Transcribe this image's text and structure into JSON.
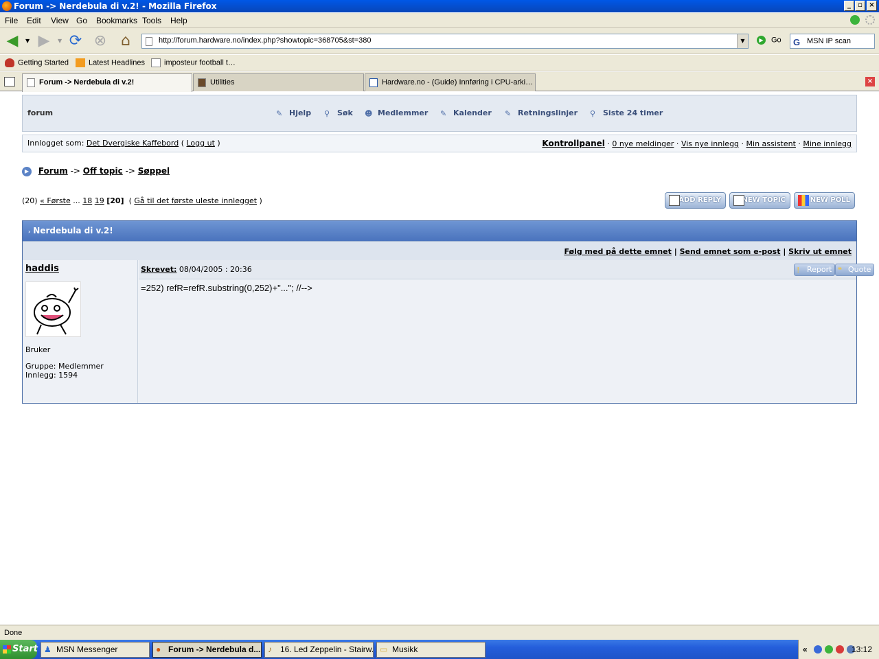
{
  "window": {
    "title": "Forum -> Nerdebula di v.2! - Mozilla Firefox"
  },
  "menubar": [
    "File",
    "Edit",
    "View",
    "Go",
    "Bookmarks",
    "Tools",
    "Help"
  ],
  "toolbar": {
    "url": "http://forum.hardware.no/index.php?showtopic=368705&st=380",
    "go_label": "Go",
    "search_value": "MSN IP scan"
  },
  "bookmarks": [
    "Getting Started",
    "Latest Headlines",
    "imposteur football t…"
  ],
  "tabs": [
    {
      "label": "Forum -> Nerdebula di v.2!"
    },
    {
      "label": "Utilities"
    },
    {
      "label": "Hardware.no - (Guide) Innføring i CPU-arki…"
    }
  ],
  "forum": {
    "logo": "forum",
    "nav": [
      "Hjelp",
      "Søk",
      "Medlemmer",
      "Kalender",
      "Retningslinjer",
      "Siste 24 timer"
    ],
    "userbar": {
      "logged_in_as": "Innlogget som:",
      "username": "Det Dvergiske Kaffebord",
      "open_paren": "(",
      "logout": "Logg ut",
      "close_paren": ")",
      "control_panel": "Kontrollpanel",
      "links": [
        "0 nye meldinger",
        "Vis nye innlegg",
        "Min assistent",
        "Mine innlegg"
      ]
    },
    "breadcrumb": [
      "Forum",
      "Off topic",
      "Søppel"
    ],
    "breadcrumb_sep": "->",
    "pager": {
      "count": "(20)",
      "first": "« Første",
      "ellipsis": "...",
      "pages": [
        "18",
        "19"
      ],
      "current": "[20]",
      "open": "(",
      "first_unread": "Gå til det første uleste innlegget",
      "close": ")"
    },
    "actions": [
      "ADD REPLY",
      "NEW TOPIC",
      "NEW POLL"
    ],
    "topic_title": "Nerdebula di v.2!",
    "topic_links": [
      "Følg med på dette emnet",
      "Send emnet som e-post",
      "Skriv ut emnet"
    ],
    "post": {
      "author": "haddis",
      "rank": "Bruker",
      "group": "Gruppe: Medlemmer",
      "posts": "Innlegg: 1594",
      "written_label": "Skrevet:",
      "date": "08/04/2005 : 20:36",
      "report_label": "Report",
      "quote_label": "Quote",
      "body": "=252) refR=refR.substring(0,252)+\"...\"; //-->"
    }
  },
  "status": "Done",
  "taskbar": {
    "start": "Start",
    "items": [
      "MSN Messenger",
      "Forum -> Nerdebula d...",
      "16. Led Zeppelin - Stairw...",
      "Musikk"
    ],
    "chevron": "«",
    "clock": "13:12"
  }
}
